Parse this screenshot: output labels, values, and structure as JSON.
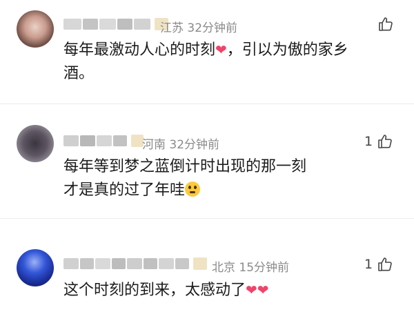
{
  "comments": [
    {
      "location": "江苏",
      "time": "32分钟前",
      "text_line1": "每年最激动人心的时刻",
      "heart": "❤",
      "text_line1_tail": "，引以为傲的家乡",
      "text_line2": "酒。",
      "like_count": ""
    },
    {
      "location": "河南",
      "time": "32分钟前",
      "text_line1": "每年等到梦之蓝倒计时出现的那一刻",
      "text_line2": "才是真的过了年哇",
      "like_count": "1"
    },
    {
      "location": "北京",
      "time": "15分钟前",
      "text_line1": "这个时刻的到来，太感动了",
      "hearts": "❤❤",
      "like_count": "1"
    }
  ],
  "colors": {
    "meta": "#8a8a8a",
    "heart": "#f0446b",
    "divider": "#ececec"
  },
  "icons": {
    "like": "thumbs-up-outline-icon"
  }
}
